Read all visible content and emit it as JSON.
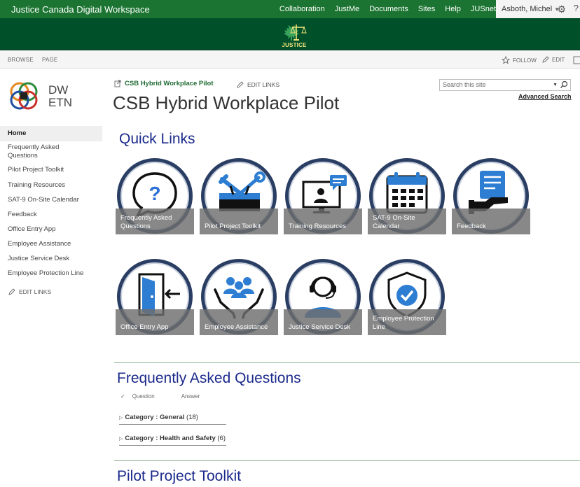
{
  "suite": {
    "title": "Justice Canada Digital Workspace",
    "links": [
      "Collaboration",
      "JustMe",
      "Documents",
      "Sites",
      "Help",
      "JUSnet"
    ],
    "user": "Asboth, Michel",
    "help_icon": "?"
  },
  "banner": {
    "logo_text": "JUSTICE"
  },
  "ribbon": {
    "browse": "BROWSE",
    "page": "PAGE",
    "follow": "FOLLOW",
    "edit": "EDIT"
  },
  "logo": {
    "line1": "DW",
    "line2": "ETN"
  },
  "leftnav": {
    "items": [
      "Home",
      "Frequently Asked Questions",
      "Pilot Project Toolkit",
      "Training Resources",
      "SAT-9 On-Site Calendar",
      "Feedback",
      "Office Entry App",
      "Employee Assistance",
      "Justice Service Desk",
      "Employee Protection Line"
    ],
    "edit_links": "EDIT LINKS"
  },
  "header": {
    "breadcrumb": "CSB Hybrid Workplace Pilot",
    "edit_links": "EDIT LINKS",
    "title": "CSB Hybrid Workplace Pilot",
    "search_placeholder": "Search this site",
    "advanced_search": "Advanced Search"
  },
  "quick_links": {
    "title": "Quick Links",
    "tiles": [
      {
        "label": "Frequently Asked Questions",
        "icon": "question-bubble-icon"
      },
      {
        "label": "Pilot Project Toolkit",
        "icon": "toolbox-icon"
      },
      {
        "label": "Training Resources",
        "icon": "monitor-presenter-icon"
      },
      {
        "label": "SAT-9 On-Site Calendar",
        "icon": "calendar-icon"
      },
      {
        "label": "Feedback",
        "icon": "feedback-hand-icon"
      },
      {
        "label": "Office Entry App",
        "icon": "door-entry-icon"
      },
      {
        "label": "Employee Assistance",
        "icon": "hands-people-icon"
      },
      {
        "label": "Justice Service Desk",
        "icon": "headset-agent-icon"
      },
      {
        "label": "Employee Protection Line",
        "icon": "shield-check-icon"
      }
    ]
  },
  "faq": {
    "title": "Frequently Asked Questions",
    "col_question": "Question",
    "col_answer": "Answer",
    "categories": [
      {
        "prefix": "Category :",
        "name": "General",
        "count": "(18)"
      },
      {
        "prefix": "Category :",
        "name": "Health and Safety",
        "count": "(6)"
      }
    ]
  },
  "toolkit": {
    "title": "Pilot Project Toolkit"
  },
  "colors": {
    "suite": "#1b7431",
    "banner": "#00502a",
    "tile_ring": "#2a3e63",
    "heading": "#1b2a8c"
  }
}
